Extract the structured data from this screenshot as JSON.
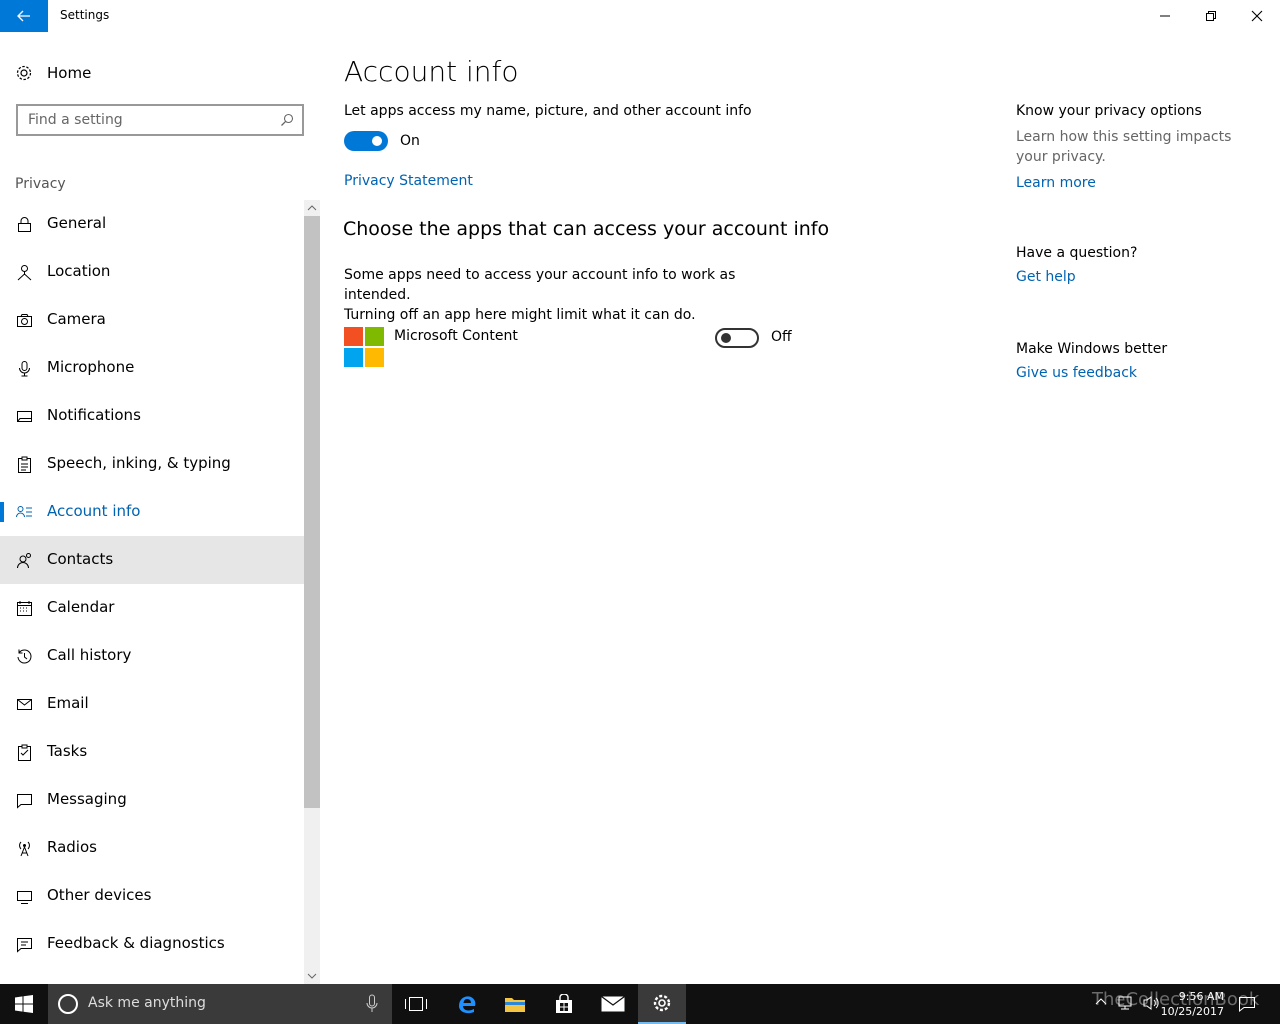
{
  "window": {
    "title": "Settings",
    "controls": [
      "minimize",
      "maximize",
      "close"
    ]
  },
  "nav": {
    "home_label": "Home",
    "search_placeholder": "Find a setting",
    "section": "Privacy",
    "items": [
      {
        "label": "General",
        "icon": "lock-icon"
      },
      {
        "label": "Location",
        "icon": "location-icon"
      },
      {
        "label": "Camera",
        "icon": "camera-icon"
      },
      {
        "label": "Microphone",
        "icon": "microphone-icon"
      },
      {
        "label": "Notifications",
        "icon": "notifications-icon"
      },
      {
        "label": "Speech, inking, & typing",
        "icon": "clipboard-icon"
      },
      {
        "label": "Account info",
        "icon": "account-info-icon",
        "selected": true
      },
      {
        "label": "Contacts",
        "icon": "contacts-icon",
        "hover": true
      },
      {
        "label": "Calendar",
        "icon": "calendar-icon"
      },
      {
        "label": "Call history",
        "icon": "history-icon"
      },
      {
        "label": "Email",
        "icon": "email-icon"
      },
      {
        "label": "Tasks",
        "icon": "tasks-icon"
      },
      {
        "label": "Messaging",
        "icon": "messaging-icon"
      },
      {
        "label": "Radios",
        "icon": "radios-icon"
      },
      {
        "label": "Other devices",
        "icon": "devices-icon"
      },
      {
        "label": "Feedback & diagnostics",
        "icon": "feedback-icon"
      }
    ]
  },
  "main": {
    "title": "Account info",
    "access_toggle": {
      "label": "Let apps access my name, picture, and other account info",
      "state": "On",
      "on": true
    },
    "privacy_link": "Privacy Statement",
    "apps_heading": "Choose the apps that can access your account info",
    "apps_description_line1": "Some apps need to access your account info to work as intended.",
    "apps_description_line2": "Turning off an app here might limit what it can do.",
    "apps": [
      {
        "name": "Microsoft Content",
        "state": "Off",
        "on": false
      }
    ]
  },
  "side": {
    "privacy_heading": "Know your privacy options",
    "privacy_desc": "Learn how this setting impacts your privacy.",
    "learn_more": "Learn more",
    "question_heading": "Have a question?",
    "get_help": "Get help",
    "better_heading": "Make Windows better",
    "feedback": "Give us feedback"
  },
  "taskbar": {
    "search_placeholder": "Ask me anything",
    "time": "9:56 AM",
    "date": "10/25/2017",
    "watermark": "TheCollectionBook"
  },
  "colors": {
    "accent": "#0078d7",
    "link": "#0063b1"
  }
}
